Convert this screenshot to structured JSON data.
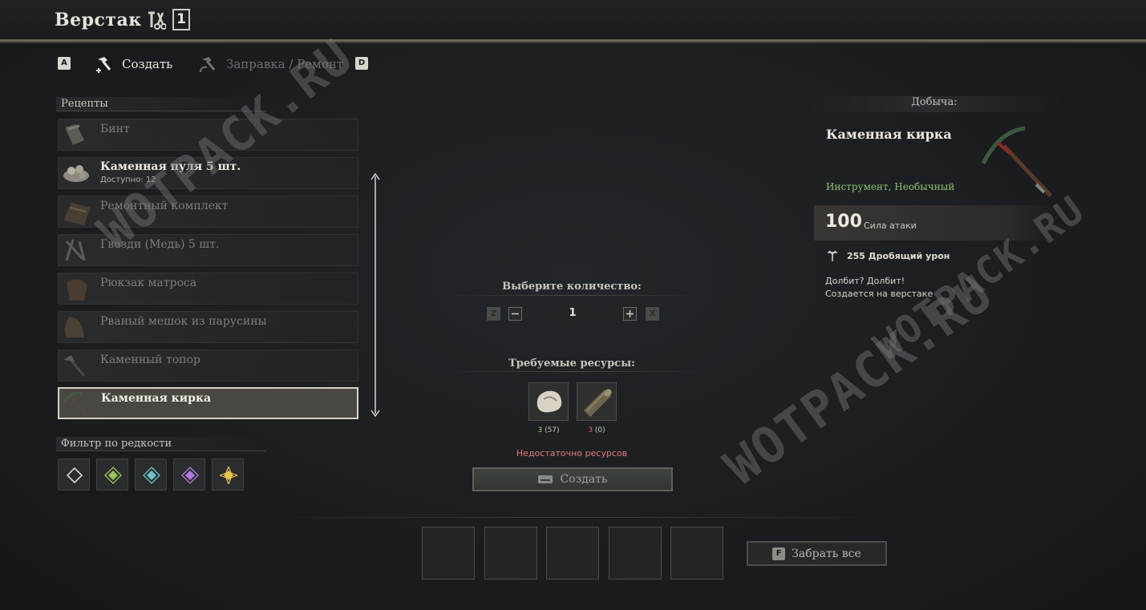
{
  "header": {
    "title": "Верстак",
    "badge": "1"
  },
  "tabs": [
    {
      "key": "A",
      "label": "Создать",
      "active": true
    },
    {
      "key": "D",
      "label": "Заправка / Ремонт",
      "active": false
    }
  ],
  "recipes": {
    "heading": "Рецепты",
    "items": [
      {
        "name": "Бинт",
        "sub": ""
      },
      {
        "name": "Каменная пуля 5 шт.",
        "sub": "Доступно: 12"
      },
      {
        "name": "Ремонтный комплект",
        "sub": ""
      },
      {
        "name": "Гвозди (Медь) 5 шт.",
        "sub": ""
      },
      {
        "name": "Рюкзак матроса",
        "sub": ""
      },
      {
        "name": "Рваный мешок из парусины",
        "sub": ""
      },
      {
        "name": "Каменный топор",
        "sub": ""
      },
      {
        "name": "Каменная кирка",
        "sub": ""
      }
    ]
  },
  "rarity_filter": {
    "heading": "Фильтр по редкости",
    "colors": [
      "#d8d6cf",
      "#9bc45a",
      "#6fc3c8",
      "#b57ae0",
      "#e6c34a"
    ]
  },
  "quantity": {
    "heading": "Выберите количество:",
    "dec_key": "Z",
    "inc_key": "X",
    "value": "1"
  },
  "resources": {
    "heading": "Требуемые ресурсы:",
    "items": [
      {
        "icon": "stone-icon",
        "need": "3",
        "have": "(57)",
        "have_color": "#9bd26a"
      },
      {
        "icon": "wood-log-icon",
        "need": "3",
        "have": "(0)",
        "have_color": "#e06a6a"
      }
    ],
    "warning": "Недостаточно ресурсов",
    "warning_color": "#e27a7a",
    "create_label": "Создать"
  },
  "output": {
    "take_key": "F",
    "take_label": "Забрать все"
  },
  "loot": {
    "heading": "Добыча:",
    "name": "Каменная кирка",
    "type": "Инструмент, Необычный",
    "stat_value": "100",
    "stat_label": "Сила атаки",
    "damage": "255 Дробящий урон",
    "desc1": "Долбит? Долбит!",
    "desc2": "Создается на верстаке"
  },
  "watermarks": [
    "WOTPACK.RU",
    "WOTPACK.RU",
    "WOTPACK.RU"
  ]
}
